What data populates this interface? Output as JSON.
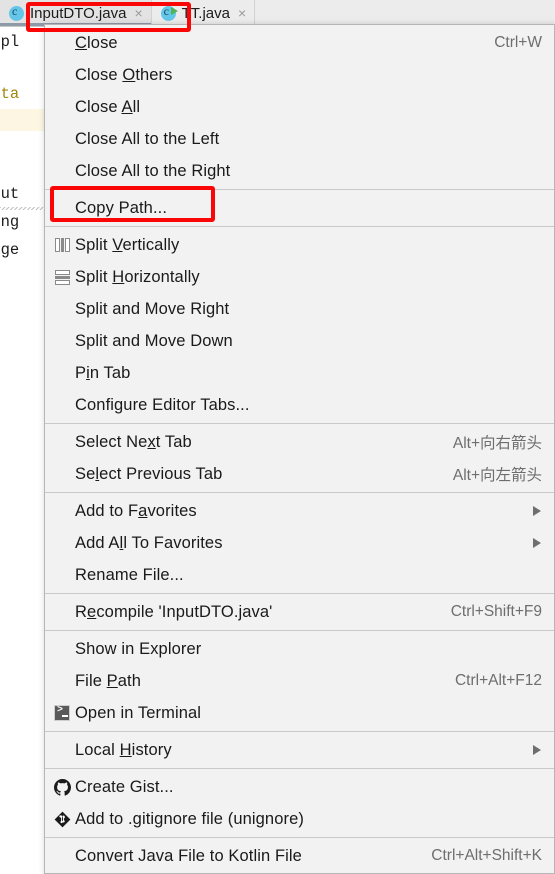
{
  "editor": {
    "tabs": [
      {
        "label": "InputDTO.java",
        "icon": "java-class-icon",
        "active": true,
        "close_glyph": "×"
      },
      {
        "label": "TT.java",
        "icon": "java-runnable-class-icon",
        "active": false,
        "close_glyph": "×"
      }
    ],
    "code_fragments": [
      "ampl",
      "Data",
      "nput",
      "ring",
      "tege"
    ]
  },
  "context_menu": {
    "groups": [
      {
        "items": [
          {
            "label": "Close",
            "mnemonic": "C",
            "shortcut": "Ctrl+W",
            "icon": null,
            "submenu": false
          },
          {
            "label": "Close Others",
            "mnemonic": "O",
            "shortcut": "",
            "icon": null,
            "submenu": false
          },
          {
            "label": "Close All",
            "mnemonic": "A",
            "shortcut": "",
            "icon": null,
            "submenu": false
          },
          {
            "label": "Close All to the Left",
            "mnemonic": "",
            "shortcut": "",
            "icon": null,
            "submenu": false
          },
          {
            "label": "Close All to the Right",
            "mnemonic": "",
            "shortcut": "",
            "icon": null,
            "submenu": false
          }
        ]
      },
      {
        "items": [
          {
            "label": "Copy Path...",
            "mnemonic": "",
            "shortcut": "",
            "icon": null,
            "submenu": false
          }
        ]
      },
      {
        "items": [
          {
            "label": "Split Vertically",
            "mnemonic": "V",
            "shortcut": "",
            "icon": "split-vertically-icon",
            "submenu": false
          },
          {
            "label": "Split Horizontally",
            "mnemonic": "H",
            "shortcut": "",
            "icon": "split-horizontally-icon",
            "submenu": false
          },
          {
            "label": "Split and Move Right",
            "mnemonic": "",
            "shortcut": "",
            "icon": null,
            "submenu": false
          },
          {
            "label": "Split and Move Down",
            "mnemonic": "",
            "shortcut": "",
            "icon": null,
            "submenu": false
          },
          {
            "label": "Pin Tab",
            "mnemonic": "i",
            "shortcut": "",
            "icon": null,
            "submenu": false
          },
          {
            "label": "Configure Editor Tabs...",
            "mnemonic": "",
            "shortcut": "",
            "icon": null,
            "submenu": false
          }
        ]
      },
      {
        "items": [
          {
            "label": "Select Next Tab",
            "mnemonic": "x",
            "shortcut": "Alt+向右箭头",
            "icon": null,
            "submenu": false
          },
          {
            "label": "Select Previous Tab",
            "mnemonic": "l",
            "shortcut": "Alt+向左箭头",
            "icon": null,
            "submenu": false
          }
        ]
      },
      {
        "items": [
          {
            "label": "Add to Favorites",
            "mnemonic": "a",
            "shortcut": "",
            "icon": null,
            "submenu": true
          },
          {
            "label": "Add All To Favorites",
            "mnemonic": "l",
            "shortcut": "",
            "icon": null,
            "submenu": true
          },
          {
            "label": "Rename File...",
            "mnemonic": "",
            "shortcut": "",
            "icon": null,
            "submenu": false
          }
        ]
      },
      {
        "items": [
          {
            "label": "Recompile 'InputDTO.java'",
            "mnemonic": "e",
            "shortcut": "Ctrl+Shift+F9",
            "icon": null,
            "submenu": false
          }
        ]
      },
      {
        "items": [
          {
            "label": "Show in Explorer",
            "mnemonic": "",
            "shortcut": "",
            "icon": null,
            "submenu": false
          },
          {
            "label": "File Path",
            "mnemonic": "P",
            "shortcut": "Ctrl+Alt+F12",
            "icon": null,
            "submenu": false
          },
          {
            "label": "Open in Terminal",
            "mnemonic": "",
            "shortcut": "",
            "icon": "terminal-icon",
            "submenu": false
          }
        ]
      },
      {
        "items": [
          {
            "label": "Local History",
            "mnemonic": "H",
            "shortcut": "",
            "icon": null,
            "submenu": true
          }
        ]
      },
      {
        "items": [
          {
            "label": "Create Gist...",
            "mnemonic": "",
            "shortcut": "",
            "icon": "github-icon",
            "submenu": false
          },
          {
            "label": "Add to .gitignore file (unignore)",
            "mnemonic": "",
            "shortcut": "",
            "icon": "git-icon",
            "submenu": false
          }
        ]
      },
      {
        "items": [
          {
            "label": "Convert Java File to Kotlin File",
            "mnemonic": "",
            "shortcut": "Ctrl+Alt+Shift+K",
            "icon": null,
            "submenu": false
          }
        ]
      }
    ]
  },
  "annotations": {
    "color": "#fb0606",
    "boxes": [
      {
        "target": "tab-InputDTO.java"
      },
      {
        "target": "menu-item-copy-path"
      }
    ]
  }
}
